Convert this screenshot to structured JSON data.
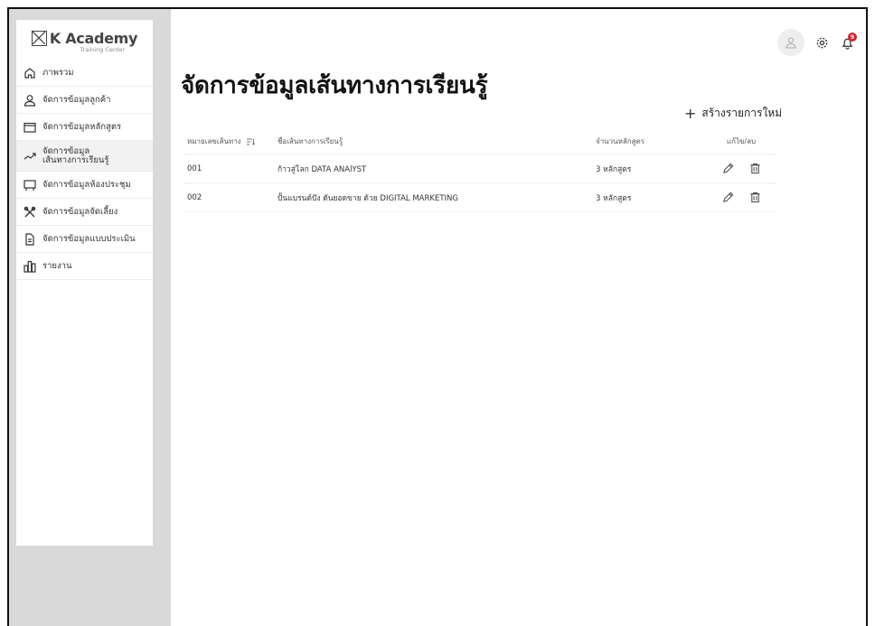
{
  "brand": {
    "name": "K Academy",
    "subtitle": "Training Center"
  },
  "sidebar": {
    "items": [
      {
        "icon": "home-icon",
        "label_line1": "ภาพรวม",
        "label_line2": ""
      },
      {
        "icon": "user-icon",
        "label_line1": "จัดการข้อมูลลูกค้า",
        "label_line2": ""
      },
      {
        "icon": "folder-icon",
        "label_line1": "จัดการข้อมูลหลักสูตร",
        "label_line2": ""
      },
      {
        "icon": "trend-icon",
        "label_line1": "จัดการข้อมูล",
        "label_line2": "เส้นทางการเรียนรู้"
      },
      {
        "icon": "meeting-room-icon",
        "label_line1": "จัดการข้อมูลห้องประชุม",
        "label_line2": ""
      },
      {
        "icon": "catering-icon",
        "label_line1": "จัดการข้อมูลจัดเลี้ยง",
        "label_line2": ""
      },
      {
        "icon": "document-icon",
        "label_line1": "จัดการข้อมูลแบบประเมิน",
        "label_line2": ""
      },
      {
        "icon": "report-icon",
        "label_line1": "รายงาน",
        "label_line2": ""
      }
    ],
    "active_index": 3
  },
  "header": {
    "title": "จัดการข้อมูลเส้นทางการเรียนรู้",
    "notification_count": "9"
  },
  "toolbar": {
    "create_label": "สร้างรายการใหม่",
    "create_icon": "plus-icon"
  },
  "table": {
    "columns": [
      "หมายเลขเส้นทาง",
      "ชื่อเส้นทางการเรียนรู้",
      "จำนวนหลักสูตร",
      "แก้ไข/ลบ"
    ],
    "rows": [
      {
        "id": "001",
        "name": "ก้าวสู่โลก DATA ANAlYST",
        "courses": "3 หลักสูตร"
      },
      {
        "id": "002",
        "name": "ปั้นแบรนด์ปัง ดันยอดขาย ด้วย DIGITAL MARKETING",
        "courses": "3 หลักสูตร"
      }
    ]
  },
  "colors": {
    "sidebar_bg": "#d9d9d9",
    "notification": "#d9232e",
    "active_item": "#f2f2f2"
  }
}
